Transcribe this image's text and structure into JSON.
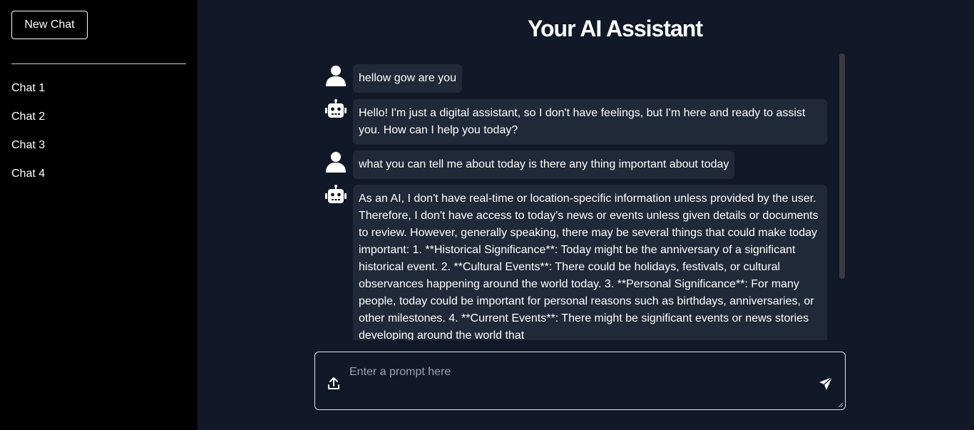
{
  "sidebar": {
    "new_chat_label": "New Chat",
    "chats": [
      "Chat 1",
      "Chat 2",
      "Chat 3",
      "Chat 4"
    ]
  },
  "header": {
    "title": "Your AI Assistant"
  },
  "messages": [
    {
      "role": "user",
      "icon": "user-icon",
      "text": "hellow gow are you"
    },
    {
      "role": "assistant",
      "icon": "robot-icon",
      "text": "Hello! I'm just a digital assistant, so I don't have feelings, but I'm here and ready to assist you. How can I help you today?"
    },
    {
      "role": "user",
      "icon": "user-icon",
      "text": "what you can tell me about today is there any thing important about today"
    },
    {
      "role": "assistant",
      "icon": "robot-icon",
      "text": "As an AI, I don't have real-time or location-specific information unless provided by the user. Therefore, I don't have access to today's news or events unless given details or documents to review. However, generally speaking, there may be several things that could make today important: 1. **Historical Significance**: Today might be the anniversary of a significant historical event. 2. **Cultural Events**: There could be holidays, festivals, or cultural observances happening around the world today. 3. **Personal Significance**: For many people, today could be important for personal reasons such as birthdays, anniversaries, or other milestones. 4. **Current Events**: There might be significant events or news stories developing around the world that"
    }
  ],
  "prompt": {
    "placeholder": "Enter a prompt here",
    "value": "",
    "upload_icon": "upload-icon",
    "send_icon": "send-icon"
  },
  "colors": {
    "sidebar_bg": "#000000",
    "main_bg": "#111827",
    "bubble_bg": "#1f2937",
    "text": "#ffffff",
    "placeholder": "#9ca3af"
  }
}
